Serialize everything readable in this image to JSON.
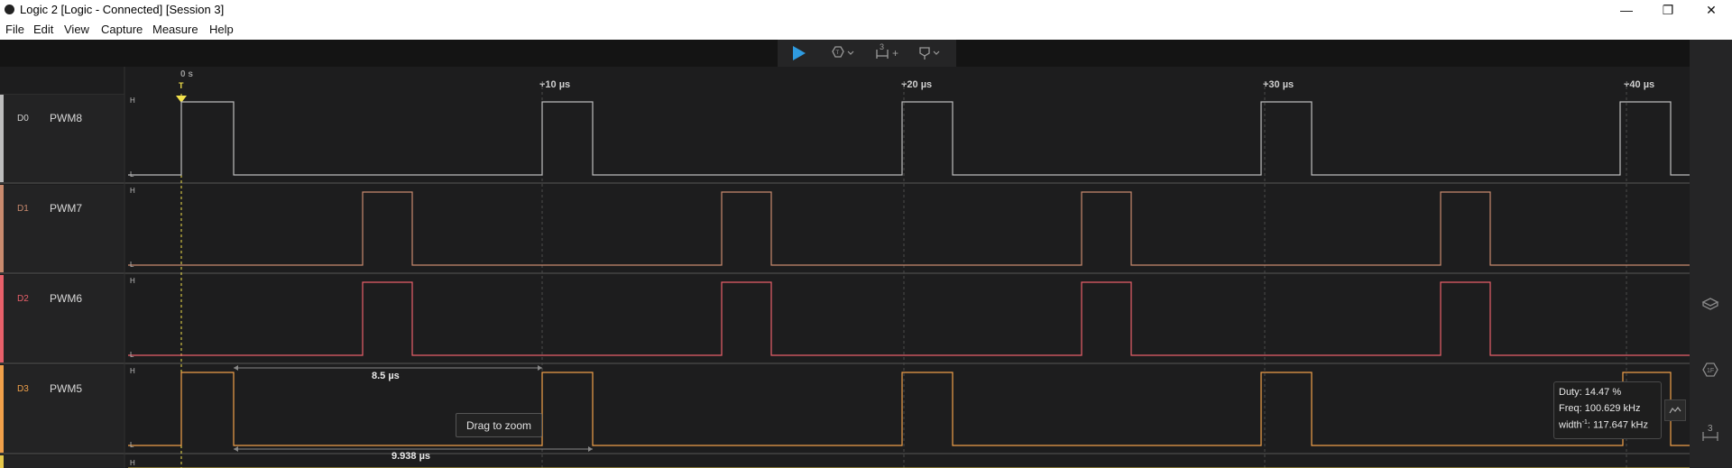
{
  "window": {
    "title": "Logic 2 [Logic - Connected] [Session 3]",
    "minimize": "—",
    "restore": "❐",
    "close": "✕"
  },
  "menu": [
    "File",
    "Edit",
    "View",
    "Capture",
    "Measure",
    "Help"
  ],
  "toolbar": {
    "play_icon": "play-icon",
    "trigger_icon": "trigger-icon",
    "measure_icon": "measure-icon",
    "measure_count": "3",
    "measure_add": "+",
    "marker_icon": "marker-icon"
  },
  "ruler": {
    "zero_label": "0 s",
    "trigger_label": "T",
    "ticks": [
      "+10 µs",
      "+20 µs",
      "+30 µs",
      "+40 µs"
    ]
  },
  "channels": [
    {
      "index": "D0",
      "name": "PWM8",
      "color": "#bdbdbd",
      "high": "H",
      "low": "L"
    },
    {
      "index": "D1",
      "name": "PWM7",
      "color": "#c98a6e",
      "high": "H",
      "low": "L"
    },
    {
      "index": "D2",
      "name": "PWM6",
      "color": "#e8606a",
      "high": "H",
      "low": "L"
    },
    {
      "index": "D3",
      "name": "PWM5",
      "color": "#f0a04a",
      "high": "H",
      "low": "L"
    },
    {
      "index": "",
      "name": "",
      "color": "#e6c84a",
      "high": "H",
      "low": ""
    }
  ],
  "measurements": {
    "width_high": "8.5 µs",
    "period": "9.938 µs",
    "drag_hint": "Drag to zoom"
  },
  "tooltip": {
    "duty": "Duty: 14.47 %",
    "freq": "Freq: 100.629 kHz",
    "width_prefix": "width",
    "width_sup": "-1",
    "width_value": ": 117.647 kHz"
  },
  "right_panel": {
    "icons": [
      "analyzers-icon",
      "extensions-icon",
      "measurements-icon"
    ],
    "measurements_count": "3"
  },
  "colors": {
    "background": "#1d1d1e",
    "accent": "#2f9be0",
    "trigger": "#f2e14c"
  }
}
